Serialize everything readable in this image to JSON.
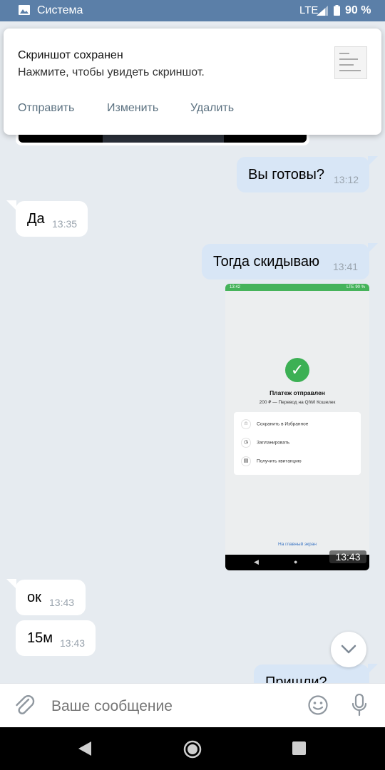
{
  "status_bar": {
    "app_name": "Система",
    "network": "LTE",
    "battery": "90 %"
  },
  "notification": {
    "title": "Скриншот сохранен",
    "body": "Нажмите, чтобы увидеть скриншот.",
    "actions": [
      "Отправить",
      "Изменить",
      "Удалить"
    ]
  },
  "messages": [
    {
      "direction": "out",
      "text": "Вы готовы?",
      "time": "13:12"
    },
    {
      "direction": "in",
      "text": "Да",
      "time": "13:35"
    },
    {
      "direction": "out",
      "text": "Тогда скидываю",
      "time": "13:41"
    },
    {
      "direction": "out",
      "type": "image",
      "time": "13:43"
    },
    {
      "direction": "in",
      "text": "ок",
      "time": "13:43"
    },
    {
      "direction": "in",
      "text": "15м",
      "time": "13:43"
    },
    {
      "direction": "out",
      "text": "Пришли?",
      "time": ""
    }
  ],
  "attached_screenshot": {
    "status_time": "13:42",
    "status_right": "LTE 90 %",
    "title": "Платеж отправлен",
    "subtitle": "200 ₽ — Перевод на QIWI Кошелек",
    "options": [
      "Сохранить в Избранное",
      "Запланировать",
      "Получить квитанцию"
    ],
    "home_link": "На главный экран"
  },
  "composer": {
    "placeholder": "Ваше сообщение"
  },
  "colors": {
    "header": "#5b7fa8",
    "outgoing_bubble": "#d8e6f6",
    "incoming_bubble": "#ffffff",
    "chat_bg": "#e6ebf0",
    "success_green": "#3cb054"
  }
}
